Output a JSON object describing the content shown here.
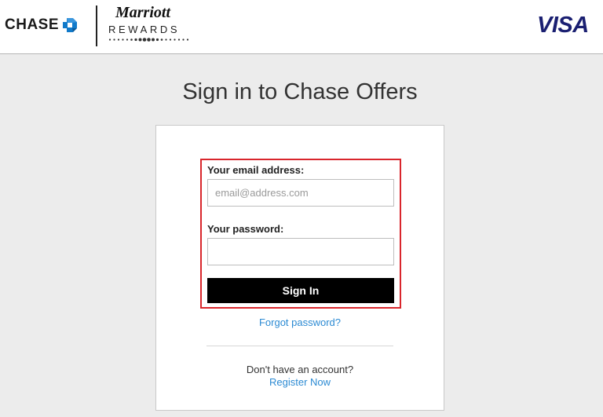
{
  "header": {
    "chase_brand": "CHASE",
    "marriott_brand": "Marriott",
    "marriott_sub": "REWARDS",
    "visa_brand": "VISA"
  },
  "page": {
    "title": "Sign in to Chase Offers"
  },
  "form": {
    "email_label": "Your email address:",
    "email_placeholder": "email@address.com",
    "email_value": "",
    "password_label": "Your password:",
    "password_value": "",
    "signin_label": "Sign In"
  },
  "links": {
    "forgot_password": "Forgot password?",
    "no_account": "Don't have an account?",
    "register": "Register Now"
  },
  "colors": {
    "accent_border": "#d9262c",
    "link": "#2b8ad3",
    "chase_blue": "#117aca",
    "visa_blue": "#1a1f71",
    "button": "#000000"
  },
  "icons": {
    "chase_logo": "chase-octagon-icon"
  }
}
